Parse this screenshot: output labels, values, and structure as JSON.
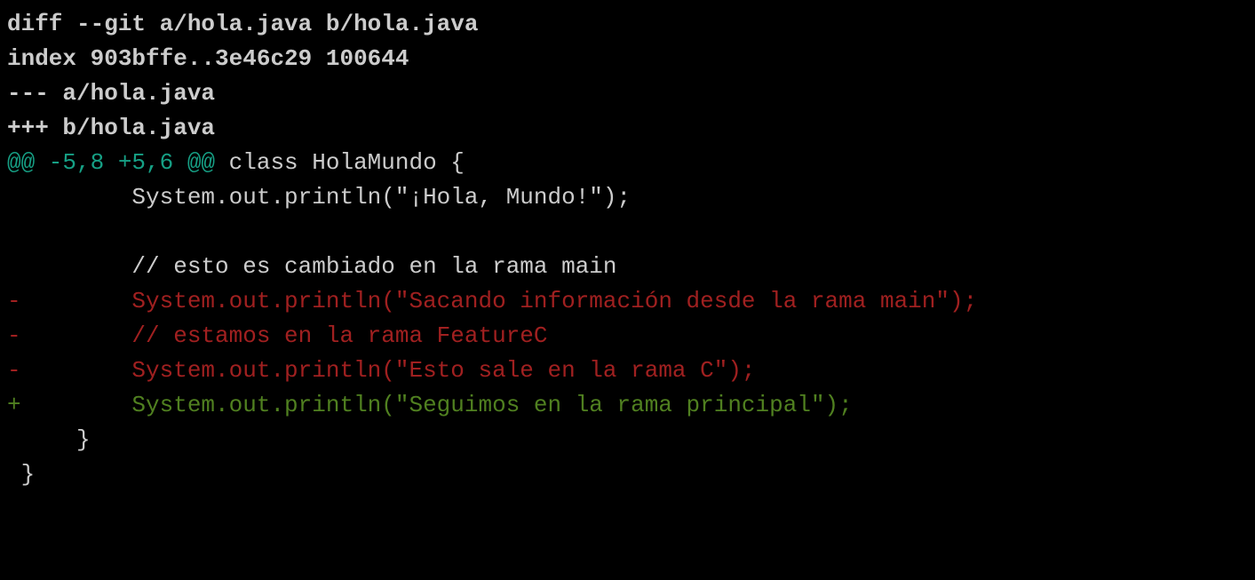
{
  "diff": {
    "header_lines": [
      "diff --git a/hola.java b/hola.java",
      "index 903bffe..3e46c29 100644",
      "--- a/hola.java",
      "+++ b/hola.java"
    ],
    "hunk_marker": "@@ -5,8 +5,6 @@",
    "hunk_context": " class HolaMundo {",
    "body_lines": [
      {
        "type": "context",
        "text": "         System.out.println(\"¡Hola, Mundo!\");"
      },
      {
        "type": "context",
        "text": " "
      },
      {
        "type": "context",
        "text": "         // esto es cambiado en la rama main"
      },
      {
        "type": "removed",
        "text": "-        System.out.println(\"Sacando información desde la rama main\");"
      },
      {
        "type": "removed",
        "text": "-        // estamos en la rama FeatureC"
      },
      {
        "type": "removed",
        "text": "-        System.out.println(\"Esto sale en la rama C\");"
      },
      {
        "type": "added",
        "text": "+        System.out.println(\"Seguimos en la rama principal\");"
      },
      {
        "type": "context",
        "text": "     }"
      },
      {
        "type": "context",
        "text": " }"
      }
    ]
  }
}
